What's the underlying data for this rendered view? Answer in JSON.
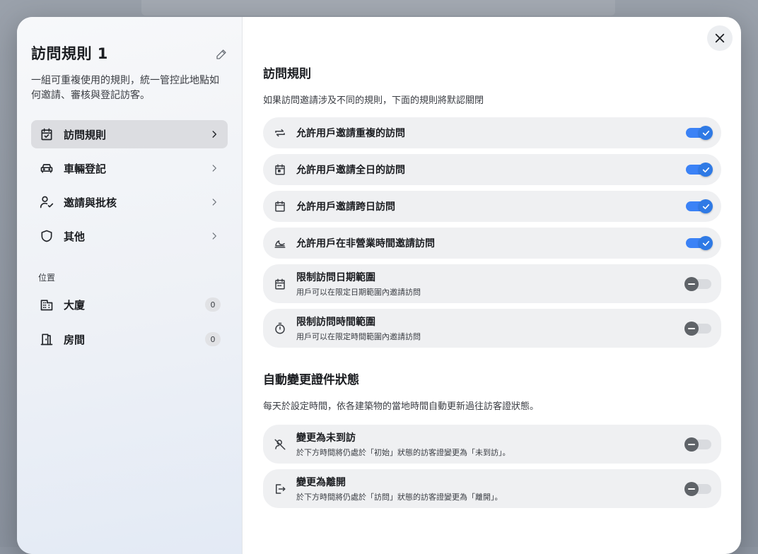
{
  "sidebar": {
    "title": "訪問規則 1",
    "description": "一組可重複使用的規則，統一管控此地點如何邀請、審核與登記訪客。",
    "nav": [
      {
        "label": "訪問規則",
        "icon": "calendar-check-icon",
        "active": true
      },
      {
        "label": "車輛登記",
        "icon": "car-icon",
        "active": false
      },
      {
        "label": "邀請與批核",
        "icon": "user-check-icon",
        "active": false
      },
      {
        "label": "其他",
        "icon": "shield-icon",
        "active": false
      }
    ],
    "locations_label": "位置",
    "locations": [
      {
        "label": "大廈",
        "count": "0",
        "icon": "building-icon"
      },
      {
        "label": "房間",
        "count": "0",
        "icon": "door-icon"
      }
    ]
  },
  "main": {
    "visit_rules": {
      "title": "訪問規則",
      "description": "如果訪問邀請涉及不同的規則，下面的規則將默認關閉",
      "rules": [
        {
          "label": "允許用戶邀請重複的訪問",
          "sub": "",
          "icon": "repeat-icon",
          "enabled": true
        },
        {
          "label": "允許用戶邀請全日的訪問",
          "sub": "",
          "icon": "calendar-day-icon",
          "enabled": true
        },
        {
          "label": "允許用戶邀請跨日訪問",
          "sub": "",
          "icon": "calendar-icon",
          "enabled": true
        },
        {
          "label": "允許用戶在非營業時間邀請訪問",
          "sub": "",
          "icon": "moon-icon",
          "enabled": true
        },
        {
          "label": "限制訪問日期範圍",
          "sub": "用戶可以在限定日期範圍內邀請訪問",
          "icon": "calendar-range-icon",
          "enabled": false
        },
        {
          "label": "限制訪問時間範圍",
          "sub": "用戶可以在限定時間範圍內邀請訪問",
          "icon": "timer-icon",
          "enabled": false
        }
      ]
    },
    "auto_status": {
      "title": "自動變更證件狀態",
      "description": "每天於設定時間，依各建築物的當地時間自動更新過往訪客證狀態。",
      "rules": [
        {
          "label": "變更為未到訪",
          "sub": "於下方時間將仍處於「初始」狀態的訪客證變更為「未到訪」。",
          "icon": "user-off-icon",
          "enabled": false
        },
        {
          "label": "變更為離開",
          "sub": "於下方時間將仍處於「訪問」狀態的訪客證變更為「離開」。",
          "icon": "logout-icon",
          "enabled": false
        }
      ]
    }
  },
  "colors": {
    "accent": "#3b82f6",
    "toggle_off_knob": "#5f6368"
  }
}
